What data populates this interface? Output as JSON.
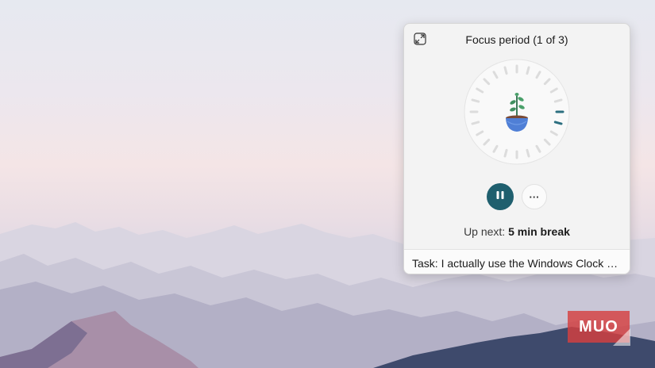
{
  "widget": {
    "title": "Focus period (1 of 3)",
    "expand_icon": "expand-window-icon",
    "dial": {
      "icon": "plant-pot-icon",
      "tick_count": 24,
      "progress_ticks": 2,
      "colors": {
        "ticks": "#dcdcdc",
        "progress": "#2c6f80",
        "face": "#f9f9f9"
      }
    },
    "controls": {
      "pause_icon": "pause-icon",
      "more_label": "···",
      "accent": "#1f5f6e"
    },
    "up_next_prefix": "Up next:",
    "up_next_value": "5 min break",
    "task_text": "Task: I actually use the Windows Clock app…"
  },
  "brand": {
    "logo_text": "MUO",
    "color": "#d64040"
  }
}
